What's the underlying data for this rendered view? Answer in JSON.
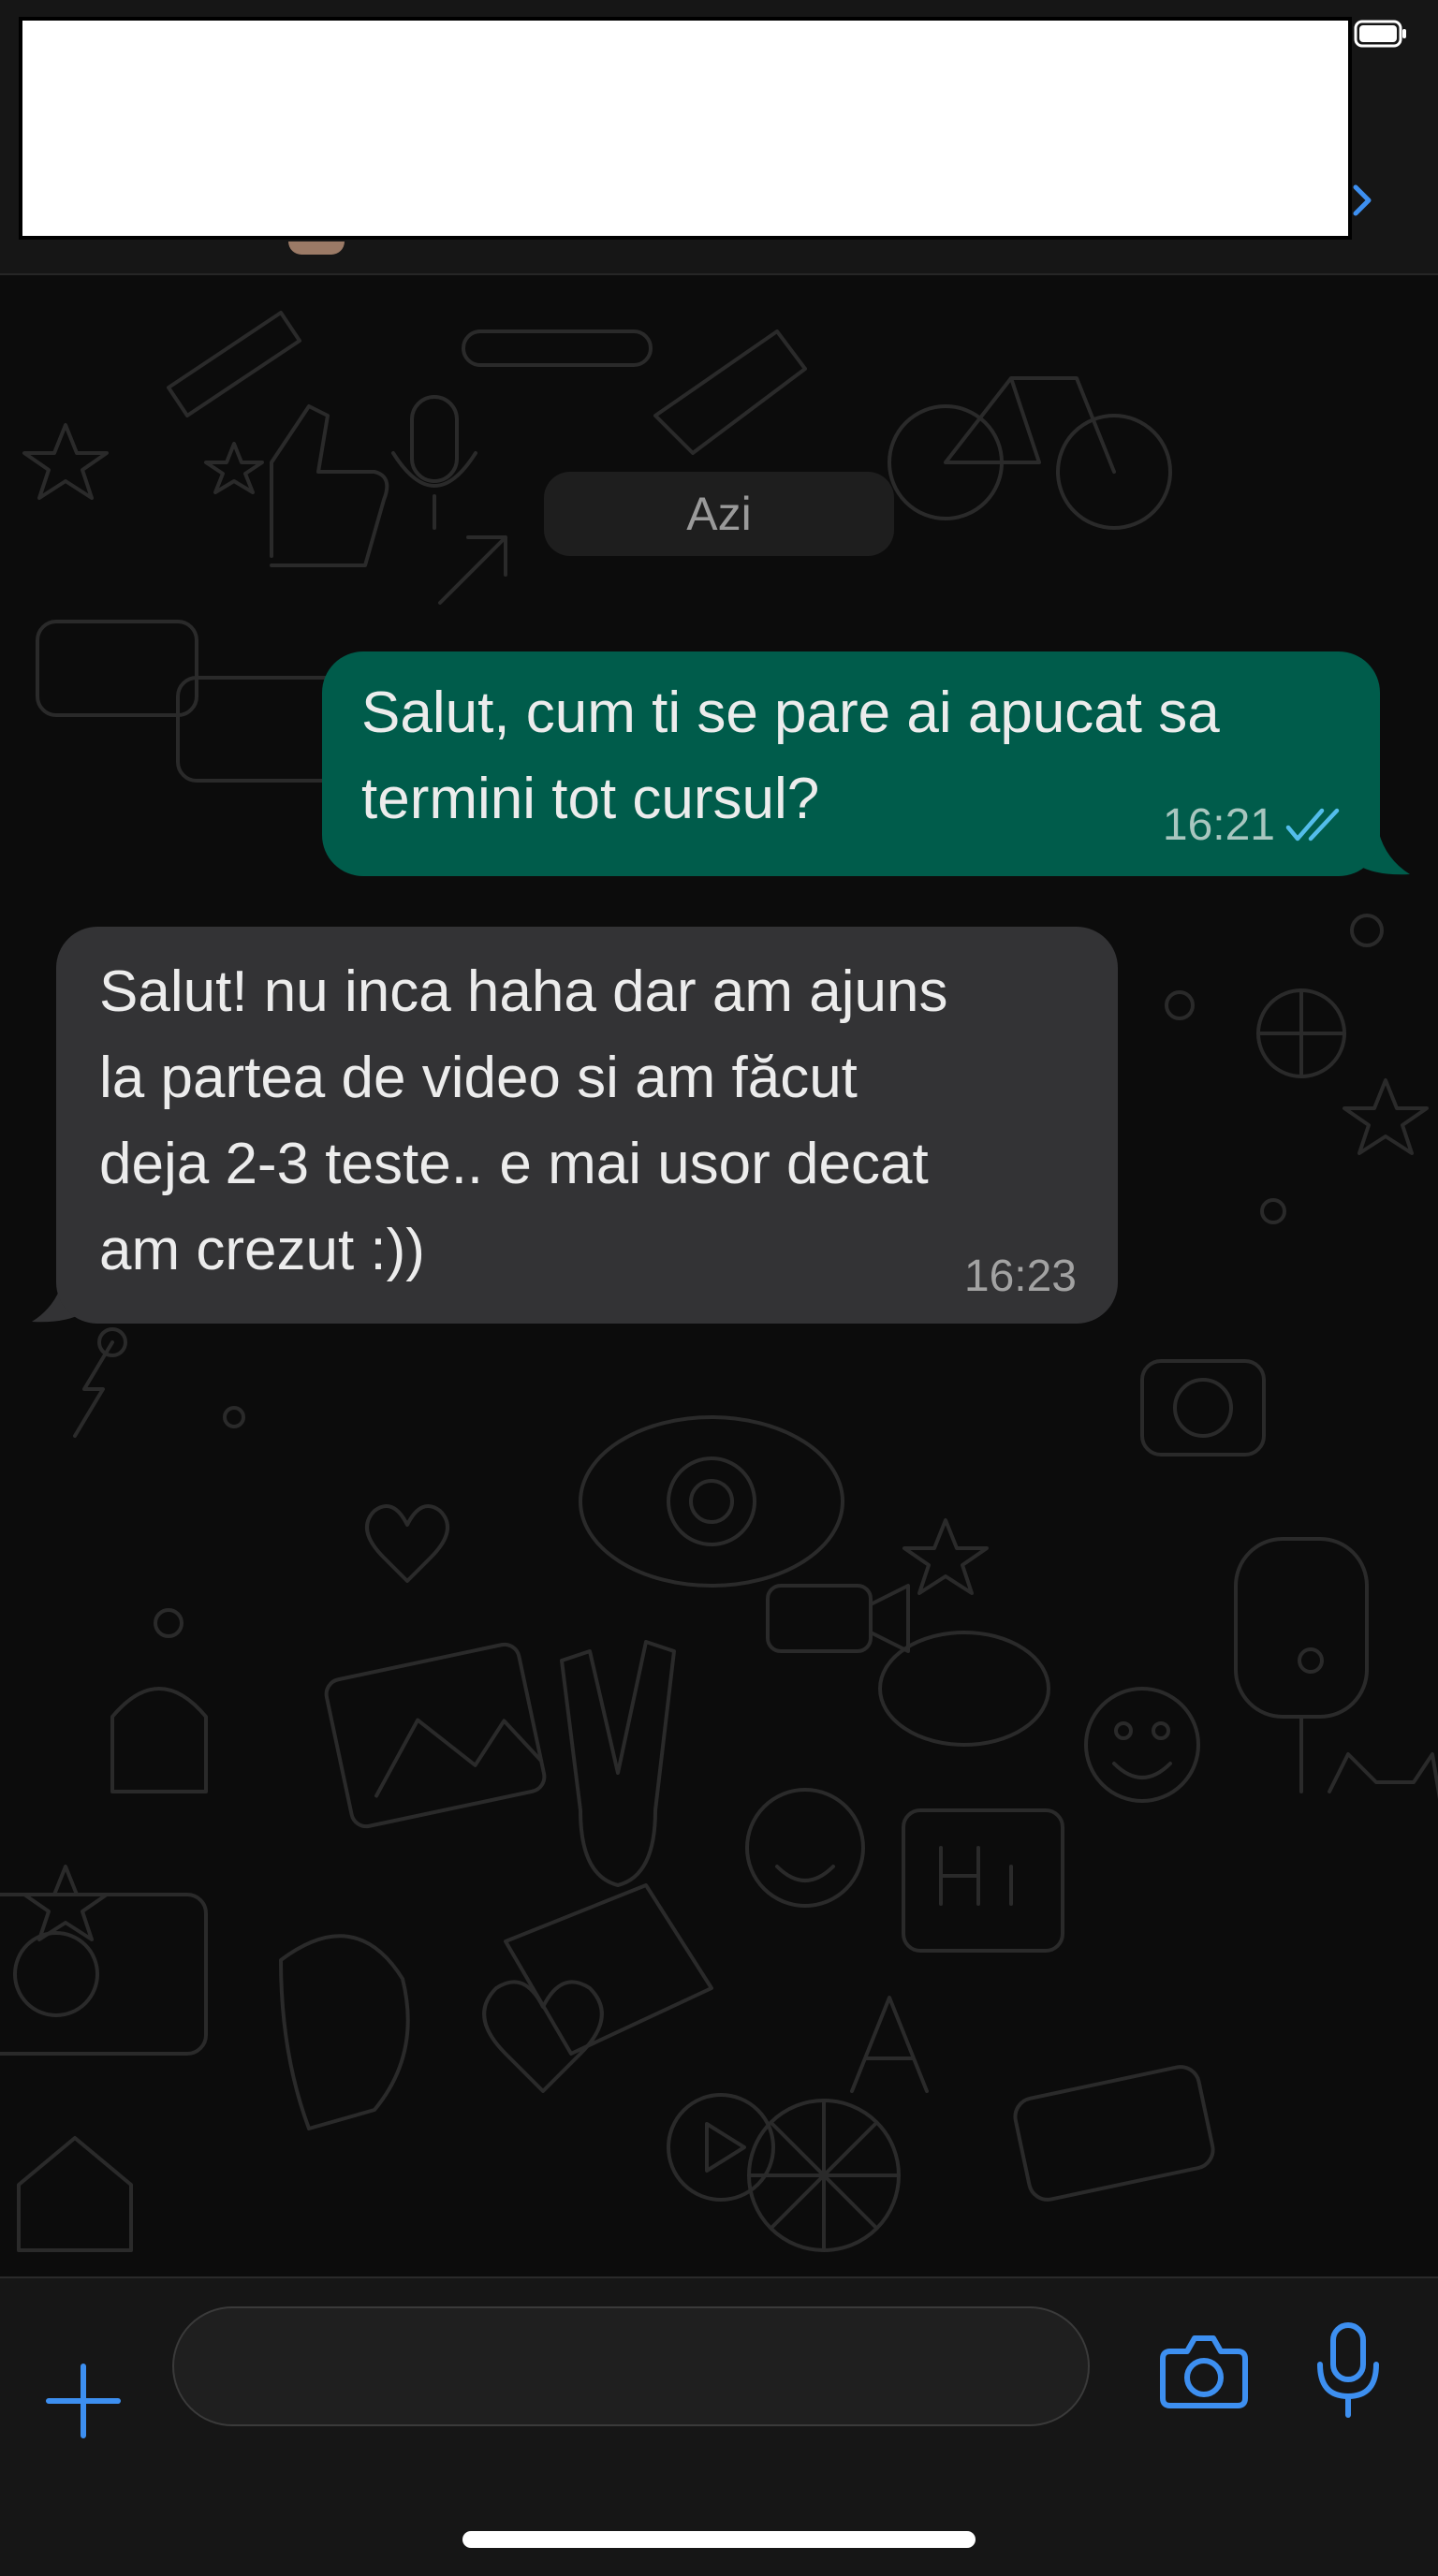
{
  "colors": {
    "accent_blue": "#3d8ff0",
    "outgoing_bubble": "#005c4b",
    "incoming_bubble": "#333335",
    "read_ticks": "#53bdeb"
  },
  "header": {
    "battery_icon": "battery-icon",
    "chevron_icon": "chevron-right-icon"
  },
  "chat": {
    "date_divider": "Azi",
    "messages": [
      {
        "direction": "outgoing",
        "text": "Salut, cum ti se pare ai apucat sa\ntermini tot cursul?",
        "time": "16:21",
        "status_icon": "double-check-read-icon"
      },
      {
        "direction": "incoming",
        "text": "Salut! nu inca haha dar am ajuns\nla partea de video si am făcut\ndeja 2-3 teste.. e mai usor decat\nam crezut :))",
        "time": "16:23"
      }
    ]
  },
  "composer": {
    "attach_icon": "plus-icon",
    "input_value": "",
    "camera_icon": "camera-icon",
    "mic_icon": "microphone-icon"
  }
}
